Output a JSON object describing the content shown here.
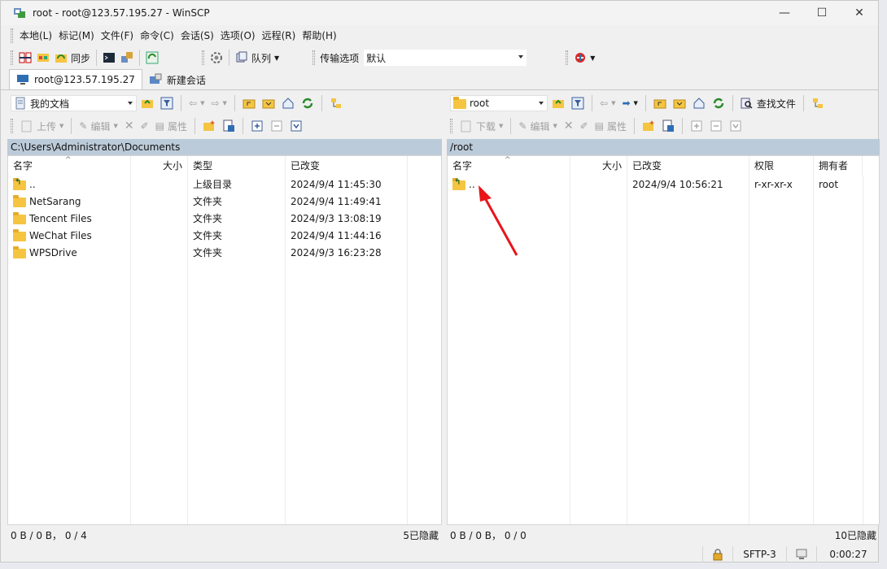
{
  "window": {
    "title": "root - root@123.57.195.27 - WinSCP"
  },
  "menu": [
    "本地(L)",
    "标记(M)",
    "文件(F)",
    "命令(C)",
    "会话(S)",
    "选项(O)",
    "远程(R)",
    "帮助(H)"
  ],
  "toolbar": {
    "sync_label": "同步",
    "queue_label": "队列",
    "transfer_label": "传输选项",
    "transfer_value": "默认"
  },
  "tabs": [
    {
      "label": "root@123.57.195.27"
    },
    {
      "label": "新建会话"
    }
  ],
  "left": {
    "location": "我的文档",
    "upload_label": "上传",
    "edit_label": "编辑",
    "props_label": "属性",
    "path": "C:\\Users\\Administrator\\Documents",
    "columns": [
      "名字",
      "大小",
      "类型",
      "已改变"
    ],
    "rows": [
      {
        "name": "..",
        "size": "",
        "type": "上级目录",
        "changed": "2024/9/4   11:45:30"
      },
      {
        "name": "NetSarang",
        "size": "",
        "type": "文件夹",
        "changed": "2024/9/4   11:49:41"
      },
      {
        "name": "Tencent Files",
        "size": "",
        "type": "文件夹",
        "changed": "2024/9/3   13:08:19"
      },
      {
        "name": "WeChat Files",
        "size": "",
        "type": "文件夹",
        "changed": "2024/9/4   11:44:16"
      },
      {
        "name": "WPSDrive",
        "size": "",
        "type": "文件夹",
        "changed": "2024/9/3   16:23:28"
      }
    ],
    "status_left": "0 B / 0 B， 0 / 4",
    "status_right": "5已隐藏"
  },
  "right": {
    "location": "root",
    "download_label": "下载",
    "edit_label": "编辑",
    "props_label": "属性",
    "find_label": "查找文件",
    "path": "/root",
    "columns": [
      "名字",
      "大小",
      "已改变",
      "权限",
      "拥有者"
    ],
    "rows": [
      {
        "name": "..",
        "size": "",
        "changed": "2024/9/4 10:56:21",
        "rights": "r-xr-xr-x",
        "owner": "root"
      }
    ],
    "status_left": "0 B / 0 B， 0 / 0",
    "status_right": "10已隐藏"
  },
  "statusbar": {
    "protocol": "SFTP-3",
    "elapsed": "0:00:27"
  },
  "colors": {
    "pathbar": "#bccbd9",
    "arrow": "#e8141a"
  }
}
